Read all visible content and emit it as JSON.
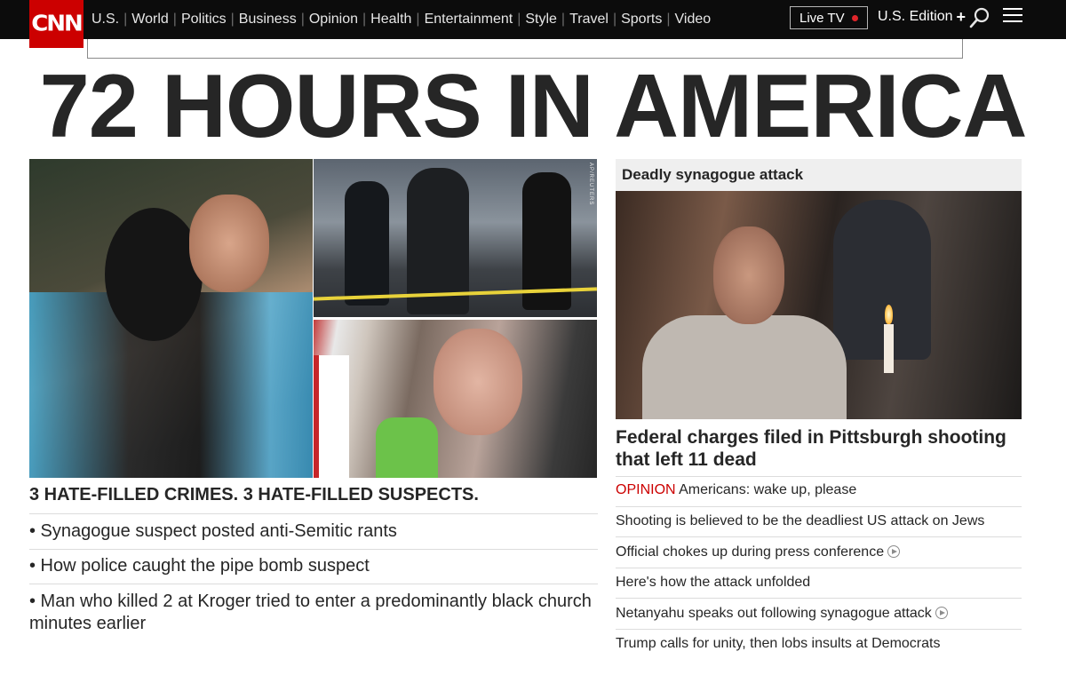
{
  "brand": {
    "logo_text": "CNN"
  },
  "nav": {
    "items": [
      "U.S.",
      "World",
      "Politics",
      "Business",
      "Opinion",
      "Health",
      "Entertainment",
      "Style",
      "Travel",
      "Sports",
      "Video"
    ],
    "separator": "|",
    "live_tv": "Live TV",
    "edition": "U.S. Edition",
    "edition_plus": "+"
  },
  "headline": "72 HOURS IN AMERICA",
  "left": {
    "kicker": "3 HATE-FILLED CRIMES. 3 HATE-FILLED SUSPECTS.",
    "links": [
      "• Synagogue suspect posted anti-Semitic rants",
      "• How police caught the pipe bomb suspect",
      "• Man who killed 2 at Kroger tried to enter a predominantly black church minutes earlier"
    ],
    "photo_credit": "AP/REUTERS"
  },
  "right": {
    "section": "Deadly synagogue attack",
    "headline": "Federal charges filed in Pittsburgh shooting that left 11 dead",
    "opinion_label": "OPINION",
    "opinion_text": "Americans: wake up, please",
    "links": [
      "Shooting is believed to be the deadliest US attack on Jews",
      "Official chokes up during press conference",
      "Here's how the attack unfolded",
      "Netanyahu speaks out following synagogue attack",
      "Trump calls for unity, then lobs insults at Democrats"
    ]
  },
  "colors": {
    "brand_red": "#cc0000",
    "nav_bg": "#0c0c0c",
    "text": "#262626",
    "rule": "#dcdcdc"
  }
}
